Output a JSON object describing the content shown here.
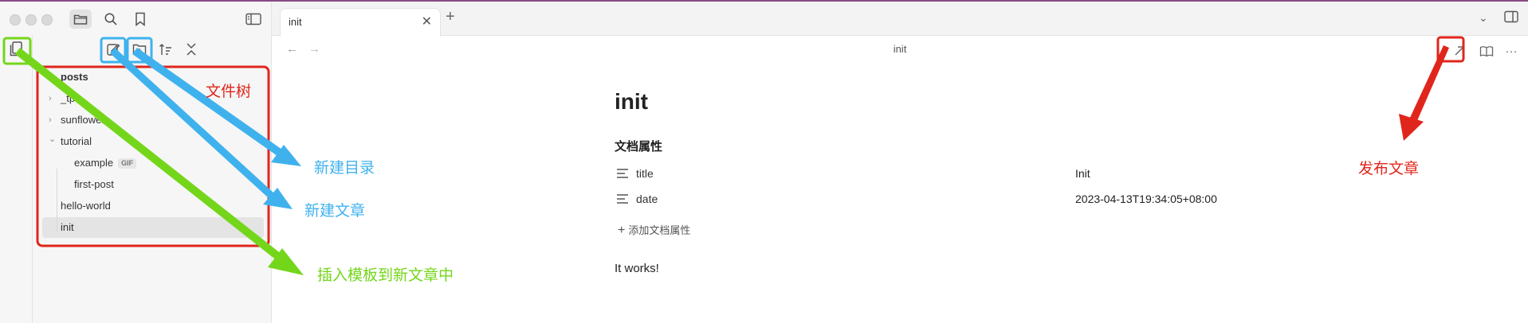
{
  "tab": {
    "title": "init"
  },
  "view_header": {
    "title": "init"
  },
  "file_tree": {
    "items": [
      {
        "label": "posts",
        "bold": true,
        "chevron": "",
        "indent": 0
      },
      {
        "label": "_tpl",
        "chevron": "›",
        "indent": 1
      },
      {
        "label": "sunflower",
        "chevron": "›",
        "indent": 1
      },
      {
        "label": "tutorial",
        "chevron": "⌄",
        "indent": 1
      },
      {
        "label": "example",
        "badge": "GIF",
        "chevron": "",
        "indent": 2
      },
      {
        "label": "first-post",
        "chevron": "",
        "indent": 2
      },
      {
        "label": "hello-world",
        "chevron": "",
        "indent": 1
      },
      {
        "label": "init",
        "active": true,
        "chevron": "",
        "indent": 1
      }
    ]
  },
  "document": {
    "title": "init",
    "properties_heading": "文档属性",
    "properties": [
      {
        "key": "title",
        "value": "Init"
      },
      {
        "key": "date",
        "value": "2023-04-13T19:34:05+08:00"
      }
    ],
    "add_property": "添加文档属性",
    "body": "It works!"
  },
  "annotations": {
    "file_tree": "文件树",
    "new_folder": "新建目录",
    "new_note": "新建文章",
    "insert_template": "插入模板到新文章中",
    "publish": "发布文章"
  },
  "colors": {
    "red": "#e0261c",
    "blue": "#3fb2ee",
    "green": "#74d61a"
  },
  "icons": [
    "folder-icon",
    "search-icon",
    "bookmark-icon",
    "sidebar-toggle-icon",
    "template-icon",
    "new-note-icon",
    "new-folder-icon",
    "sort-icon",
    "collapse-icon",
    "back-icon",
    "forward-icon",
    "publish-icon",
    "reading-view-icon",
    "more-icon",
    "close-icon",
    "plus-icon",
    "chevron-down-icon",
    "right-sidebar-icon",
    "text-property-icon"
  ]
}
